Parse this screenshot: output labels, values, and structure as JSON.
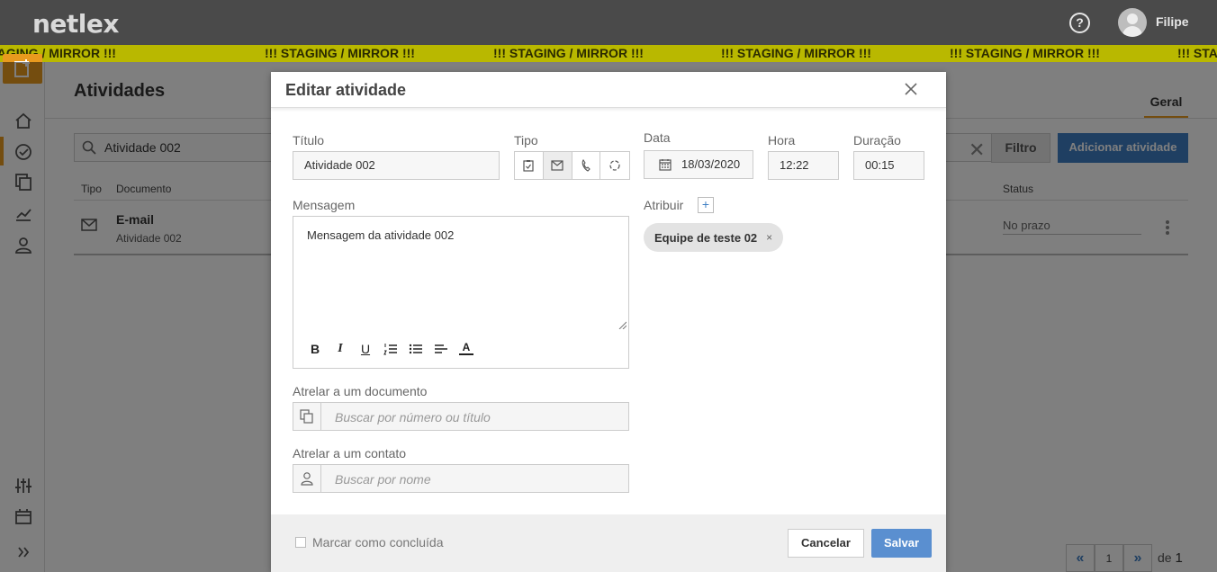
{
  "app": {
    "logo": "netlex",
    "username": "Filipe",
    "help": "?"
  },
  "banner": {
    "text": "!!! STAGING / MIRROR !!!"
  },
  "page": {
    "title": "Atividades",
    "tab": "Geral",
    "search_value": "Atividade 002",
    "filter_label": "Filtro",
    "add_label": "Adicionar atividade",
    "columns": {
      "tipo": "Tipo",
      "documento": "Documento",
      "status": "Status"
    },
    "row": {
      "title": "E-mail",
      "subtitle": "Atividade 002",
      "status": "No prazo"
    },
    "pagination": {
      "current": "1",
      "of_label": "de",
      "total": "1",
      "prev": "«",
      "next": "»"
    }
  },
  "modal": {
    "title": "Editar atividade",
    "titulo_label": "Título",
    "titulo_value": "Atividade 002",
    "tipo_label": "Tipo",
    "tipo_selected": "email",
    "data_label": "Data",
    "data_value": "18/03/2020",
    "hora_label": "Hora",
    "hora_value": "12:22",
    "duracao_label": "Duração",
    "duracao_value": "00:15",
    "mensagem_label": "Mensagem",
    "mensagem_value": "Mensagem da atividade 002",
    "toolbar": {
      "bold": "B",
      "italic": "I",
      "underline": "U",
      "font_color": "A"
    },
    "atribuir_label": "Atribuir",
    "atribuir_plus": "+",
    "assigned": "Equipe de teste 02",
    "chip_remove": "×",
    "doc_label": "Atrelar a um documento",
    "doc_placeholder": "Buscar por número ou título",
    "contact_label": "Atrelar a um contato",
    "contact_placeholder": "Buscar por nome",
    "concluida_label": "Marcar como concluída",
    "cancel_label": "Cancelar",
    "save_label": "Salvar"
  },
  "colors": {
    "accent": "#e89a1e",
    "primary": "#3f7fc4",
    "banner": "#b9b800",
    "topbar": "#4a4a4a"
  }
}
